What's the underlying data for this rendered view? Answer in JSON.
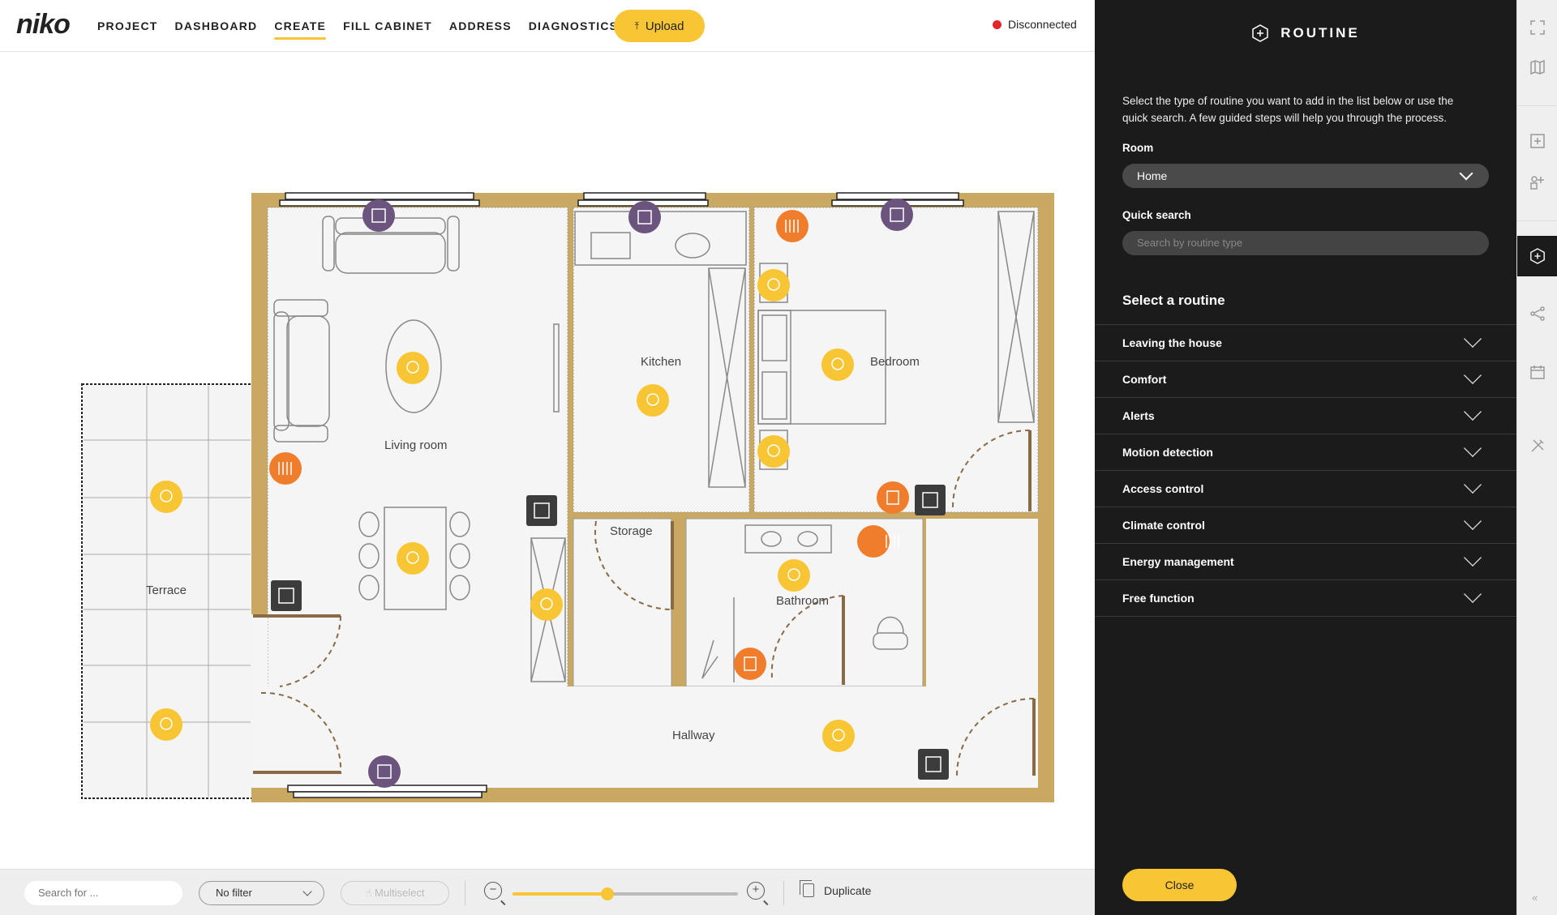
{
  "app": {
    "logo": "niko",
    "nav": [
      {
        "label": "PROJECT",
        "active": false
      },
      {
        "label": "DASHBOARD",
        "active": false
      },
      {
        "label": "CREATE",
        "active": true
      },
      {
        "label": "FILL CABINET",
        "active": false
      },
      {
        "label": "ADDRESS",
        "active": false
      },
      {
        "label": "DIAGNOSTICS",
        "active": false
      }
    ],
    "upload_label": "Upload",
    "status_label": "Disconnected"
  },
  "floorplan": {
    "rooms": [
      {
        "name": "Living room"
      },
      {
        "name": "Kitchen"
      },
      {
        "name": "Bedroom"
      },
      {
        "name": "Storage"
      },
      {
        "name": "Bathroom"
      },
      {
        "name": "Terrace"
      },
      {
        "name": "Hallway"
      }
    ]
  },
  "toolbar": {
    "search_placeholder": "Search for ...",
    "filter_label": "No filter",
    "multiselect_label": "Multiselect",
    "zoom_level": 0.42,
    "duplicate_label": "Duplicate"
  },
  "panel": {
    "title": "ROUTINE",
    "description": "Select the type of routine you want to add in the list below or use the quick search. A few guided steps will help you through the process.",
    "room_label": "Room",
    "room_value": "Home",
    "quick_search_label": "Quick search",
    "quick_search_placeholder": "Search by routine type",
    "select_heading": "Select a routine",
    "routines": [
      "Leaving the house",
      "Comfort",
      "Alerts",
      "Motion detection",
      "Access control",
      "Climate control",
      "Energy management",
      "Free function"
    ],
    "close_label": "Close"
  },
  "colors": {
    "accent": "#f8c534",
    "panel_bg": "#1b1b1b",
    "wall": "#c9a961",
    "light_icon": "#f8c534",
    "heating_icon": "#f07d2c",
    "blind_icon": "#6b557e",
    "status_red": "#e3262b"
  }
}
